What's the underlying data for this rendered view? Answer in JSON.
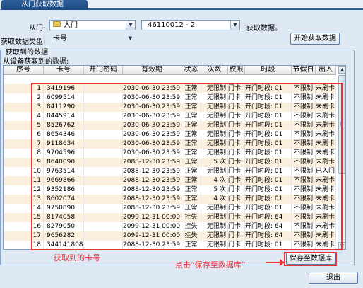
{
  "window": {
    "tab_title": "从门获取数据"
  },
  "form": {
    "door_label": "从门:",
    "door_value": "大门",
    "controller_info": "46110012 - 2",
    "action_hint": "获取数据。",
    "type_label": "获取数据类型:",
    "type_value": "卡号",
    "start_button": "开始获取数据"
  },
  "group": {
    "title": "获取到的数据",
    "subtitle": "从设备获取到的数据:"
  },
  "table": {
    "columns": [
      "序号",
      "卡号",
      "开门密码",
      "有效期",
      "状态",
      "次数",
      "权限",
      "时段",
      "节假日",
      "出入"
    ],
    "rows": [
      [
        "1",
        "3419196",
        "",
        "2030-06-30 23:59",
        "正常",
        "无限制",
        "门卡",
        "开门时段: 01",
        "不限制",
        "未刷卡"
      ],
      [
        "2",
        "6099514",
        "",
        "2030-06-30 23:59",
        "正常",
        "无限制",
        "门卡",
        "开门时段: 01",
        "不限制",
        "未刷卡"
      ],
      [
        "3",
        "8411290",
        "",
        "2030-06-30 23:59",
        "正常",
        "无限制",
        "门卡",
        "开门时段: 01",
        "不限制",
        "未刷卡"
      ],
      [
        "4",
        "8445914",
        "",
        "2030-06-30 23:59",
        "正常",
        "无限制",
        "门卡",
        "开门时段: 01",
        "不限制",
        "未刷卡"
      ],
      [
        "5",
        "8526762",
        "",
        "2030-06-30 23:59",
        "正常",
        "无限制",
        "门卡",
        "开门时段: 01",
        "不限制",
        "未刷卡"
      ],
      [
        "6",
        "8654346",
        "",
        "2030-06-30 23:59",
        "正常",
        "无限制",
        "门卡",
        "开门时段: 01",
        "不限制",
        "未刷卡"
      ],
      [
        "7",
        "9118634",
        "",
        "2030-06-30 23:59",
        "正常",
        "无限制",
        "门卡",
        "开门时段: 01",
        "不限制",
        "未刷卡"
      ],
      [
        "8",
        "9704596",
        "",
        "2030-06-30 23:59",
        "正常",
        "无限制",
        "门卡",
        "开门时段: 01",
        "不限制",
        "未刷卡"
      ],
      [
        "9",
        "8640090",
        "",
        "2088-12-30 23:59",
        "正常",
        "5 次",
        "门卡",
        "开门时段: 01",
        "不限制",
        "未刷卡"
      ],
      [
        "10",
        "9763514",
        "",
        "2088-12-30 23:59",
        "正常",
        "无限制",
        "门卡",
        "开门时段: 01",
        "不限制",
        "已入门"
      ],
      [
        "11",
        "9669866",
        "",
        "2088-12-30 23:59",
        "正常",
        "4 次",
        "门卡",
        "开门时段: 01",
        "不限制",
        "未刷卡"
      ],
      [
        "12",
        "9352186",
        "",
        "2088-12-30 23:59",
        "正常",
        "5 次",
        "门卡",
        "开门时段: 01",
        "不限制",
        "未刷卡"
      ],
      [
        "13",
        "8602074",
        "",
        "2088-12-30 23:59",
        "正常",
        "4 次",
        "门卡",
        "开门时段: 01",
        "不限制",
        "未刷卡"
      ],
      [
        "14",
        "9750890",
        "",
        "2088-12-30 23:59",
        "正常",
        "无限制",
        "门卡",
        "开门时段: 01",
        "不限制",
        "未刷卡"
      ],
      [
        "15",
        "8174058",
        "",
        "2099-12-31 00:00",
        "挂失",
        "无限制",
        "门卡",
        "开门时段: 64",
        "不限制",
        "未刷卡"
      ],
      [
        "16",
        "8279050",
        "",
        "2099-12-31 00:00",
        "挂失",
        "无限制",
        "门卡",
        "开门时段: 64",
        "不限制",
        "未刷卡"
      ],
      [
        "17",
        "9656282",
        "",
        "2099-12-31 00:00",
        "挂失",
        "无限制",
        "门卡",
        "开门时段: 64",
        "不限制",
        "未刷卡"
      ],
      [
        "18",
        "344141808",
        "",
        "2088-12-30 23:59",
        "正常",
        "无限制",
        "门卡",
        "开门时段: 01",
        "不限制",
        "未刷卡"
      ]
    ]
  },
  "buttons": {
    "save": "保存至数据库",
    "exit": "退出"
  },
  "annotations": {
    "cards_label": "获取到的卡号",
    "save_hint": "点击“保存至数据库”"
  },
  "colors": {
    "annotation_red": "#e8323a",
    "alt_row": "#fbf0dd",
    "tab_blue": "#1b4a82"
  }
}
